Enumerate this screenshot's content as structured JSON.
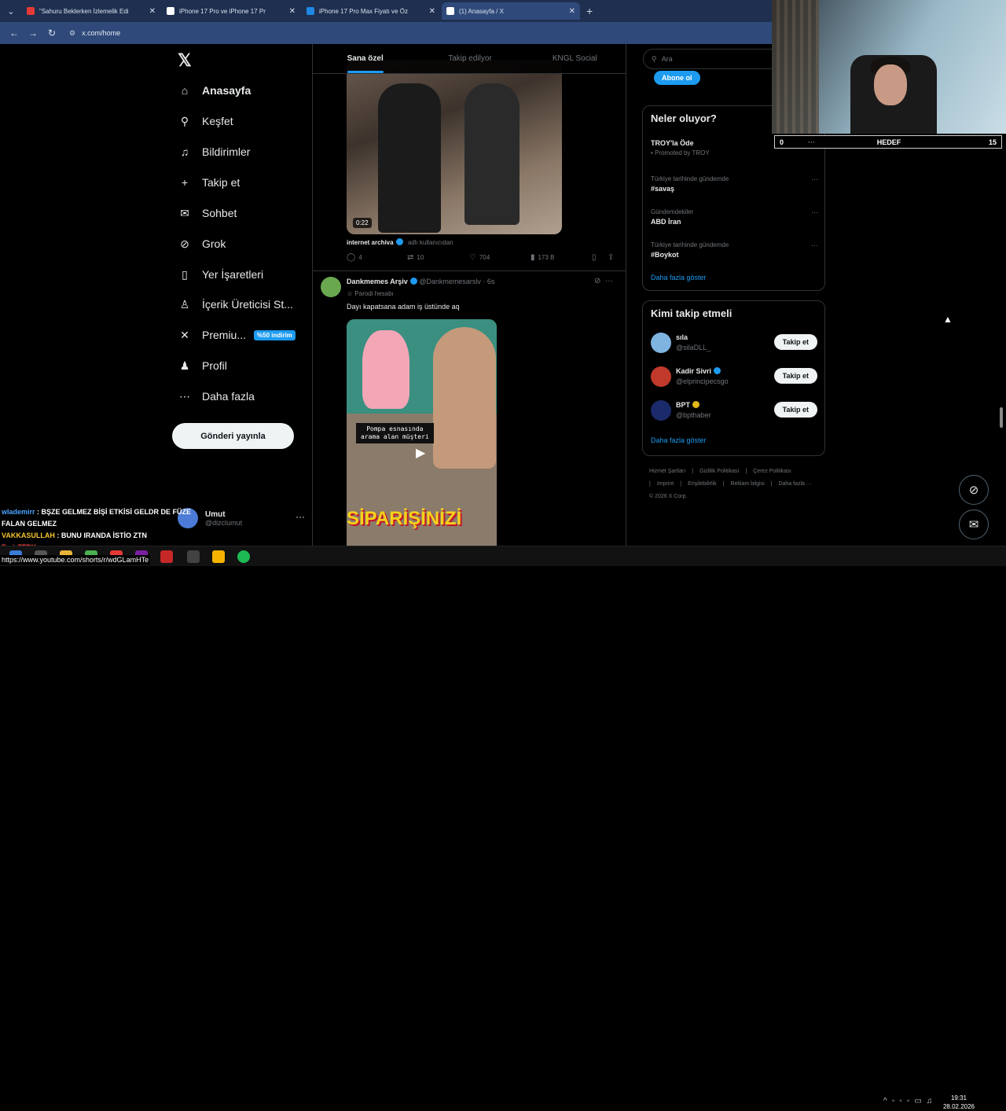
{
  "browser": {
    "tabs": [
      {
        "title": "\"Sahuru Beklerken İzlemelik Edi",
        "favicon_color": "#e53935",
        "active": false
      },
      {
        "title": "iPhone 17 Pro ve iPhone 17 Pr",
        "favicon_color": "#ffffff",
        "active": false
      },
      {
        "title": "iPhone 17 Pro Max Fiyatı ve Öz",
        "favicon_color": "#1e88e5",
        "active": false
      },
      {
        "title": "(1) Anasayfa / X",
        "favicon_color": "#ffffff",
        "active": true
      }
    ],
    "url": "x.com/home"
  },
  "sidebar": {
    "items": [
      {
        "label": "Anasayfa",
        "icon": "home-icon",
        "glyph": "⌂"
      },
      {
        "label": "Keşfet",
        "icon": "search-icon",
        "glyph": "⚲"
      },
      {
        "label": "Bildirimler",
        "icon": "bell-icon",
        "glyph": "♫"
      },
      {
        "label": "Takip et",
        "icon": "person-add-icon",
        "glyph": "+"
      },
      {
        "label": "Sohbet",
        "icon": "mail-icon",
        "glyph": "✉"
      },
      {
        "label": "Grok",
        "icon": "grok-icon",
        "glyph": "⊘"
      },
      {
        "label": "Yer İşaretleri",
        "icon": "bookmark-icon",
        "glyph": "▯"
      },
      {
        "label": "İçerik Üreticisi St...",
        "icon": "creator-icon",
        "glyph": "♙"
      },
      {
        "label": "Premiu...",
        "icon": "x-icon",
        "glyph": "✕"
      },
      {
        "label": "Profil",
        "icon": "profile-icon",
        "glyph": "♟"
      },
      {
        "label": "Daha fazla",
        "icon": "more-icon",
        "glyph": "⋯"
      }
    ],
    "premium_badge": "%50 indirim",
    "post_button": "Gönderi yayınla",
    "account": {
      "name": "Umut",
      "handle": "@dizclumut"
    }
  },
  "feed": {
    "tabs": [
      "Sana özel",
      "Takip edilyor",
      "KNGL Social"
    ],
    "post1": {
      "duration": "0:22",
      "source_name": "internet archiva",
      "source_handle": "adlı kullanıcıdan",
      "replies": "4",
      "reposts": "10",
      "likes": "704",
      "views": "173 B"
    },
    "post2": {
      "author": "Dankmemes Arşiv",
      "handle": "@Dankmemesarslv",
      "time": "· 6s",
      "label": "Parodi hesabı",
      "text": "Dayı kapatsana adam iş üstünde aq",
      "video_caption_line1": "Pompa esnasında",
      "video_caption_line2": "arama alan müşteri",
      "video_overlay": "SİPARİŞİNİZİ"
    }
  },
  "right": {
    "search_placeholder": "Ara",
    "subscribe_button": "Abone ol",
    "trends_title": "Neler oluyor?",
    "promoted": {
      "title": "TROY'la Öde",
      "sub": "Promoted by TROY"
    },
    "trends": [
      {
        "context": "Türkiye tarihinde gündemde",
        "title": "#savaş"
      },
      {
        "context": "Gündemdekiler",
        "title": "ABD İran"
      },
      {
        "context": "Türkiye tarihinde gündemde",
        "title": "#Boykot"
      }
    ],
    "show_more": "Daha fazla göster",
    "who_title": "Kimi takip etmeli",
    "who": [
      {
        "name": "sıla",
        "handle": "@silaDLL_",
        "color": "#7fb3e0",
        "verified": ""
      },
      {
        "name": "Kadir Sivri",
        "handle": "@elprincipecsgo",
        "color": "#c0392b",
        "verified": "blue"
      },
      {
        "name": "BPT",
        "handle": "@bpthaber",
        "color": "#1b2a6b",
        "verified": "gold"
      }
    ],
    "follow_label": "Takip et",
    "footer_links": [
      "Hizmet Şartları",
      "|",
      "Gizlilik Politikası",
      "|",
      "Çerez Politikası",
      "|",
      "Imprint",
      "|",
      "Erişilebilirlik",
      "|",
      "Reklam bilgisi",
      "|",
      "Daha fazla ···",
      "© 2026 X Corp."
    ]
  },
  "overlay": {
    "goal_left": "0",
    "goal_dots": "···",
    "goal_label": "HEDEF",
    "goal_right": "15",
    "chat": [
      {
        "user": "wlademirr",
        "msg": " : BŞZE GELMEZ BİŞİ ETKİSİ GELDR DE FÜZE FALAN GELMEZ"
      },
      {
        "user": "VAKKASULLAH",
        "msg": " : BUNU IRANDA İSTİO ZTN"
      },
      {
        "user": "EmirZTRK",
        "msg": " :"
      }
    ]
  },
  "status_url": "https://www.youtube.com/shorts/r/wdGLamHTe",
  "clock": {
    "time": "19:31",
    "date": "28.02.2026"
  }
}
